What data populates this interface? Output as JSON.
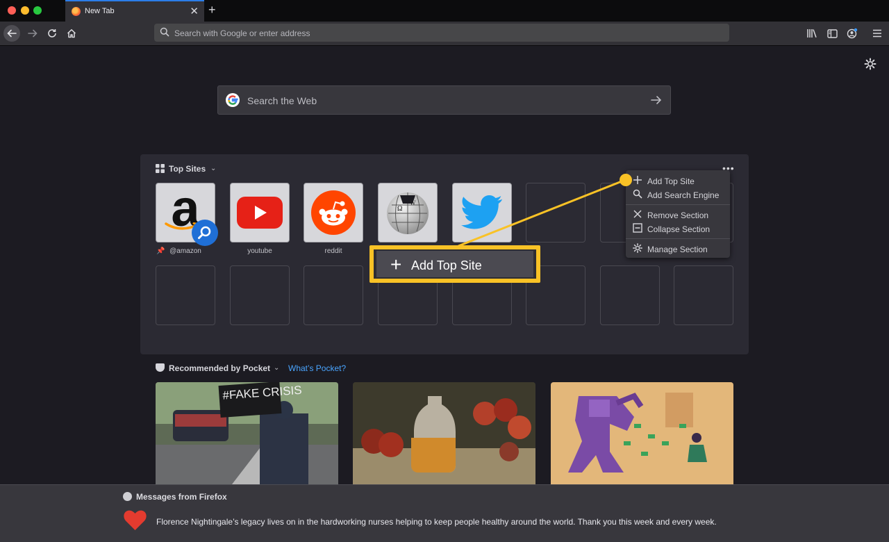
{
  "browser": {
    "tab": {
      "title": "New Tab"
    },
    "urlbar": {
      "placeholder": "Search with Google or enter address"
    }
  },
  "newtab": {
    "web_search": {
      "placeholder": "Search the Web"
    },
    "top_sites": {
      "title": "Top Sites",
      "tiles": [
        {
          "label": "@amazon",
          "icon": "amazon-logo"
        },
        {
          "label": "youtube",
          "icon": "youtube-logo"
        },
        {
          "label": "reddit",
          "icon": "reddit-logo"
        },
        {
          "label": "",
          "icon": "wikipedia-logo"
        },
        {
          "label": "",
          "icon": "twitter-logo"
        }
      ],
      "menu": {
        "add_top_site": "Add Top Site",
        "add_search_engine": "Add Search Engine",
        "remove_section": "Remove Section",
        "collapse_section": "Collapse Section",
        "manage_section": "Manage Section"
      }
    },
    "callout": {
      "label": "Add Top Site",
      "color": "#f9c226"
    },
    "pocket": {
      "title": "Recommended by Pocket",
      "link": "What’s Pocket?",
      "card1_sign": "#FAKE CRISIS"
    }
  },
  "messages": {
    "title": "Messages from Firefox",
    "text": "Florence Nightingale’s legacy lives on in the hardworking nurses helping to keep people healthy around the world. Thank you this week and every week."
  },
  "colors": {
    "accent": "#2b7de9",
    "link": "#4aa5ff",
    "highlight": "#f9c226",
    "heart": "#e33b2f"
  }
}
